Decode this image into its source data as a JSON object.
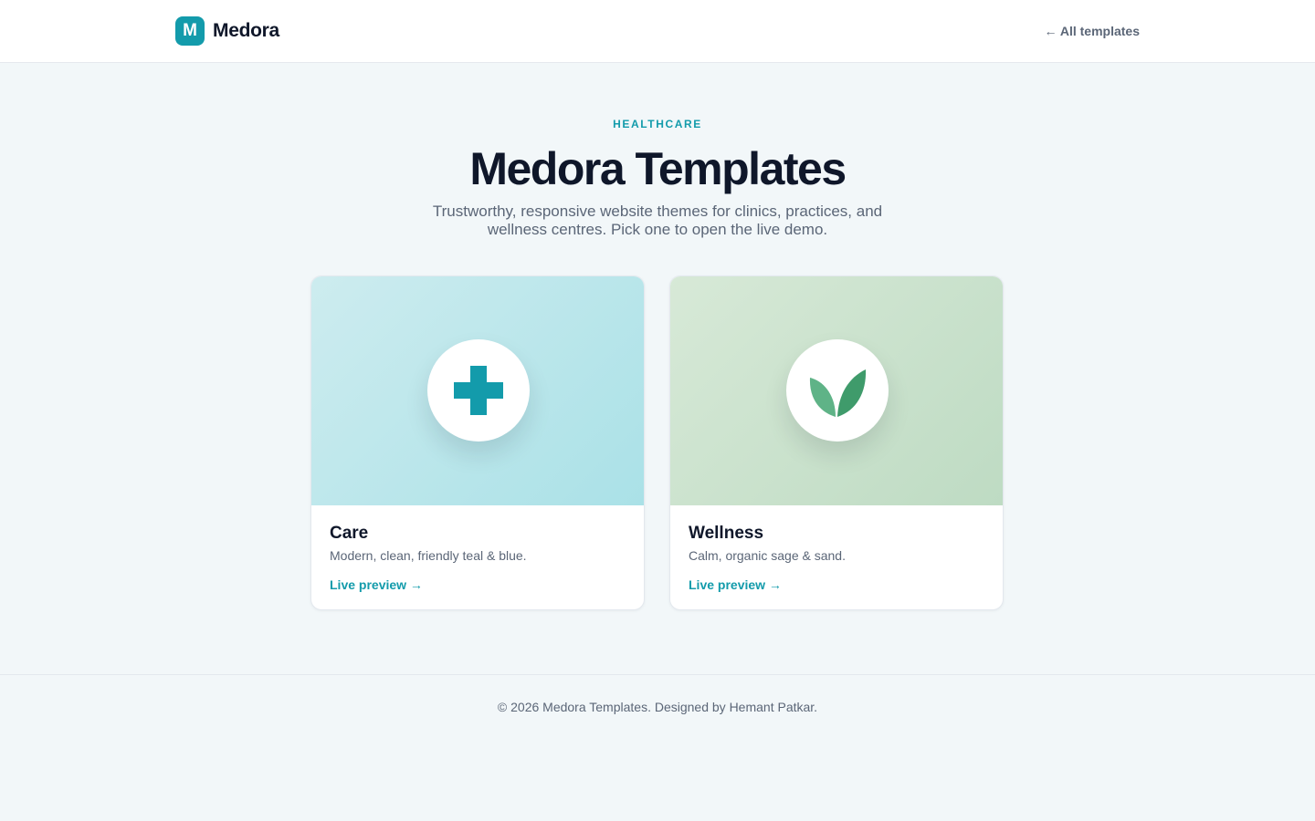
{
  "header": {
    "logo_letter": "M",
    "brand": "Medora",
    "all_templates_link": "← All templates"
  },
  "hero": {
    "eyebrow": "HEALTHCARE",
    "title": "Medora Templates",
    "subtitle": "Trustworthy, responsive website themes for clinics, practices, and wellness centres. Pick one to open the live demo."
  },
  "cards": [
    {
      "title": "Care",
      "description": "Modern, clean, friendly teal & blue.",
      "link": "Live preview →",
      "icon": "medical-cross-icon",
      "icon_color": "#139bab"
    },
    {
      "title": "Wellness",
      "description": "Calm, organic sage & sand.",
      "link": "Live preview →",
      "icon": "leaf-icon",
      "icon_color": "#3f9b6b"
    }
  ],
  "footer": {
    "text": "© 2026 Medora Templates. Designed by Hemant Patkar."
  },
  "colors": {
    "accent": "#139bab",
    "heading": "#0f172a",
    "muted": "#5b6677",
    "background": "#f2f7f9"
  }
}
